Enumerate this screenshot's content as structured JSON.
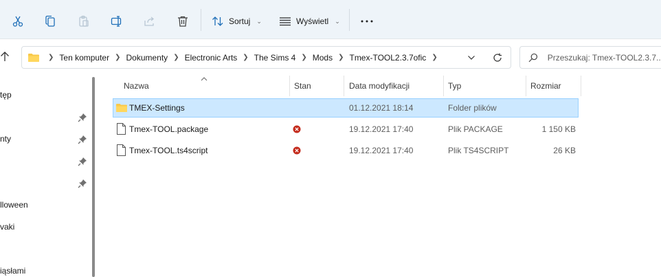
{
  "toolbar": {
    "sort_label": "Sortuj",
    "view_label": "Wyświetl",
    "icons": [
      "cut-icon",
      "copy-icon",
      "paste-icon",
      "rename-icon",
      "share-icon",
      "delete-icon",
      "sort-icon",
      "view-icon",
      "more-icon"
    ]
  },
  "address": {
    "crumbs": [
      "Ten komputer",
      "Dokumenty",
      "Electronic Arts",
      "The Sims 4",
      "Mods",
      "Tmex-TOOL2.3.7ofic"
    ]
  },
  "search": {
    "placeholder": "Przeszukaj: Tmex-TOOL2.3.7..."
  },
  "sidebar": {
    "items": [
      {
        "label": "tęp"
      },
      {
        "label": "nty"
      },
      {
        "label": "lloween"
      },
      {
        "label": "vaki"
      },
      {
        "label": "iąsłami"
      }
    ]
  },
  "columns": {
    "name": "Nazwa",
    "status": "Stan",
    "modified": "Data modyfikacji",
    "type": "Typ",
    "size": "Rozmiar"
  },
  "files": [
    {
      "name": "TMEX-Settings",
      "status": "",
      "modified": "01.12.2021 18:14",
      "type": "Folder plików",
      "size": "",
      "icon": "folder-icon"
    },
    {
      "name": "Tmex-TOOL.package",
      "status": "error",
      "modified": "19.12.2021 17:40",
      "type": "Plik PACKAGE",
      "size": "1 150 KB",
      "icon": "file-icon"
    },
    {
      "name": "Tmex-TOOL.ts4script",
      "status": "error",
      "modified": "19.12.2021 17:40",
      "type": "Plik TS4SCRIPT",
      "size": "26 KB",
      "icon": "file-icon"
    }
  ],
  "colors": {
    "selection": "#cce8ff",
    "selection_border": "#99d1ff",
    "toolbar_bg": "#eef4f9",
    "folder": "#f8c94a",
    "error": "#c42b1c"
  }
}
